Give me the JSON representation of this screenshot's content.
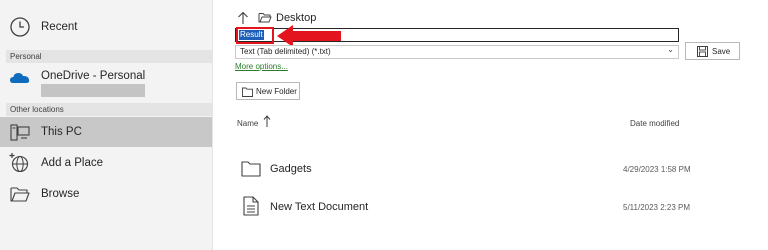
{
  "sidebar": {
    "recent_label": "Recent",
    "personal_header": "Personal",
    "onedrive_label": "OneDrive - Personal",
    "other_header": "Other locations",
    "thispc_label": "This PC",
    "addplace_label": "Add a Place",
    "browse_label": "Browse"
  },
  "location": {
    "current": "Desktop"
  },
  "save": {
    "filename_value": "Result",
    "file_type": "Text (Tab delimited) (*.txt)",
    "more_options": "More options...",
    "save_label": "Save",
    "new_folder_label": "New Folder"
  },
  "list": {
    "name_header": "Name",
    "date_header": "Date modified",
    "rows": [
      {
        "name": "Gadgets",
        "date": "4/29/2023 1:58 PM",
        "icon": "folder-icon"
      },
      {
        "name": "New Text Document",
        "date": "5/11/2023 2:23 PM",
        "icon": "document-icon"
      }
    ]
  },
  "colors": {
    "annotation_red": "#e3141e",
    "onedrive_blue": "#0f6cbd",
    "selection_blue": "#1d5fb8",
    "link_green": "#2b7a2b"
  }
}
